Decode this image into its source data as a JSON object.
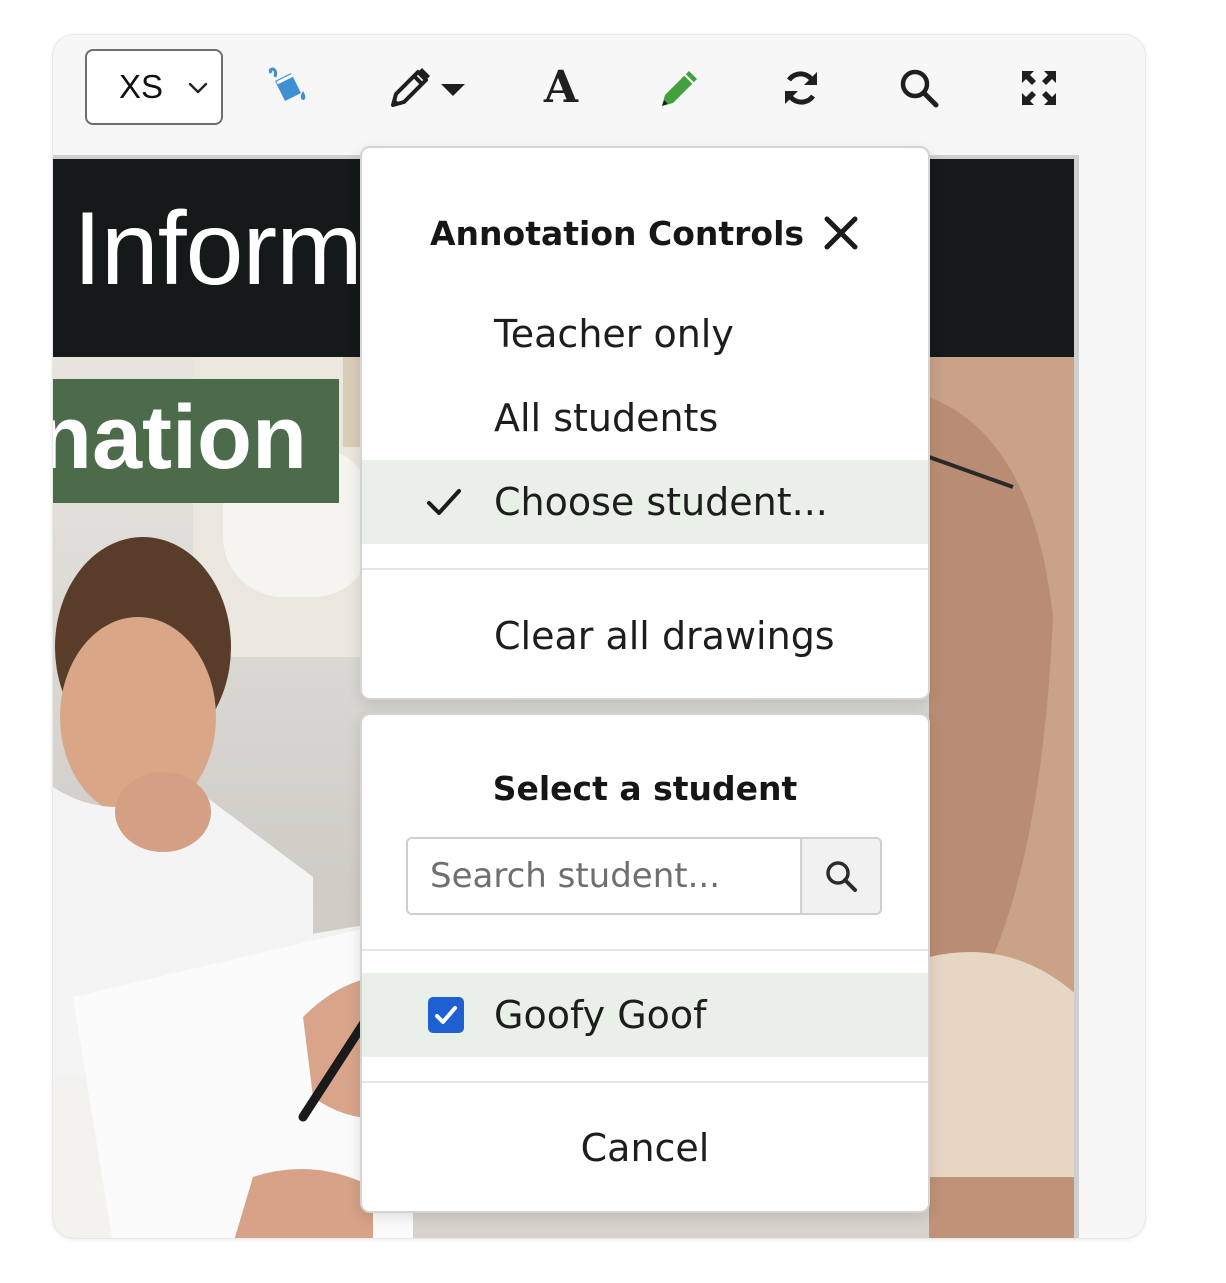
{
  "toolbar": {
    "size_select": {
      "value": "XS"
    },
    "tools": [
      {
        "name": "fill-icon",
        "color": "#3f8fd6"
      },
      {
        "name": "pencil-dropdown-icon",
        "color": "#1f1f1f"
      },
      {
        "name": "text-icon",
        "label": "A",
        "color": "#1f1f1f"
      },
      {
        "name": "highlighter-pencil-icon",
        "color": "#43a03f"
      },
      {
        "name": "refresh-icon",
        "color": "#1f1f1f"
      },
      {
        "name": "search-icon",
        "color": "#1f1f1f"
      },
      {
        "name": "fullscreen-icon",
        "color": "#1f1f1f"
      }
    ]
  },
  "viewer": {
    "banner_title": "Inform",
    "banner_label": "nation"
  },
  "annotation_panel": {
    "title": "Annotation Controls",
    "items": [
      {
        "label": "Teacher only",
        "selected": false
      },
      {
        "label": "All students",
        "selected": false
      },
      {
        "label": "Choose student...",
        "selected": true
      }
    ],
    "clear_label": "Clear all drawings",
    "selected_bg": "#e9f0e8"
  },
  "student_panel": {
    "title": "Select a student",
    "search_placeholder": "Search student...",
    "students": [
      {
        "name": "Goofy Goof",
        "checked": true
      }
    ],
    "cancel_label": "Cancel",
    "checkbox_color": "#1e5fd1"
  }
}
